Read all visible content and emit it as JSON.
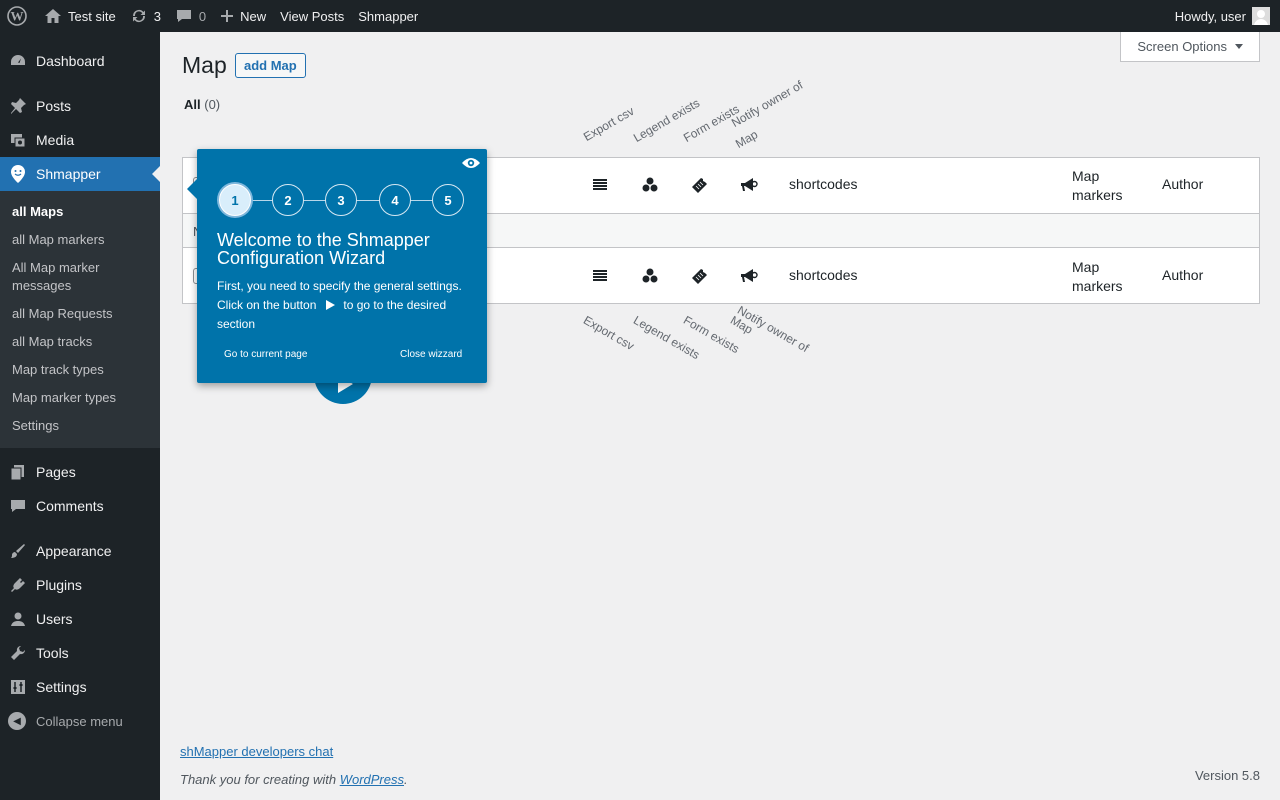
{
  "adminbar": {
    "site_name": "Test site",
    "updates_count": "3",
    "comments_count": "0",
    "new_label": "New",
    "view_posts": "View Posts",
    "plugin_link": "Shmapper",
    "howdy": "Howdy, user"
  },
  "sidebar": {
    "dashboard": "Dashboard",
    "posts": "Posts",
    "media": "Media",
    "shmapper": "Shmapper",
    "submenu": [
      "all Maps",
      "all Map markers",
      "All Map marker messages",
      "all Map Requests",
      "all Map tracks",
      "Map track types",
      "Map marker types",
      "Settings"
    ],
    "pages": "Pages",
    "comments": "Comments",
    "appearance": "Appearance",
    "plugins": "Plugins",
    "users": "Users",
    "tools": "Tools",
    "settings": "Settings",
    "collapse": "Collapse menu"
  },
  "main": {
    "screen_options": "Screen Options",
    "title": "Map",
    "add_button": "add Map",
    "views_all": "All",
    "views_count": "(0)",
    "column_headers": [
      "Export csv",
      "Legend exists",
      "Form exists",
      "Notify owner of Map"
    ],
    "notify_line1": "Notify owner of",
    "notify_line2": "Map",
    "col_shortcodes": "shortcodes",
    "col_markers_line1": "Map",
    "col_markers_line2": "markers",
    "col_author": "Author",
    "no_items_initial": "N"
  },
  "wizard": {
    "steps": [
      "1",
      "2",
      "3",
      "4",
      "5"
    ],
    "active_step": 1,
    "title": "Welcome to the Shmapper Configuration Wizard",
    "body_line1": "First, you need to specify the general settings.",
    "body_line2a": "Click on the button",
    "body_line2b": "to go to the desired",
    "body_line3": "section",
    "link_current": "Go to current page",
    "link_close": "Close wizzard",
    "icons": [
      "eye-icon",
      "play-icon"
    ]
  },
  "footer": {
    "chat_link": "shMapper developers chat",
    "thanks_prefix": "Thank you for creating with",
    "thanks_link": "WordPress",
    "thanks_suffix": ".",
    "version": "Version 5.8"
  },
  "colors": {
    "adminbar_bg": "#1d2327",
    "menu_current": "#2271b1",
    "wizard_bg": "#0073aa",
    "link": "#2271b1"
  }
}
